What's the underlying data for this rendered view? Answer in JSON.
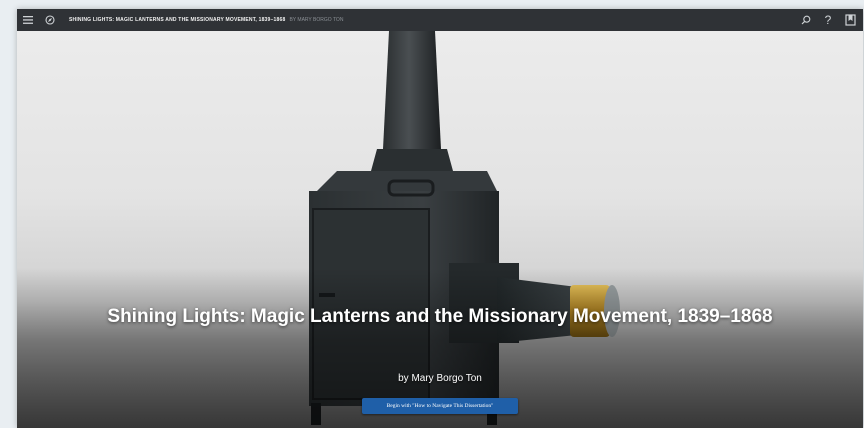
{
  "topbar": {
    "title": "SHINING LIGHTS: MAGIC LANTERNS AND THE MISSIONARY MOVEMENT, 1839–1868",
    "author": "BY MARY BORGO TON",
    "icons": [
      "menu-icon",
      "compass-icon",
      "search-icon",
      "help-icon",
      "bookmark-icon"
    ],
    "help_glyph": "?"
  },
  "hero": {
    "title": "Shining Lights: Magic Lanterns and the Missionary Movement, 1839–1868",
    "byline": "by Mary Borgo Ton",
    "button_label": "Begin with \"How to Navigate This Dissertation\""
  },
  "colors": {
    "topbar": "#2f3236",
    "button": "#1f5fa8",
    "lantern": "#1f2325",
    "brass": "#c9a035"
  }
}
